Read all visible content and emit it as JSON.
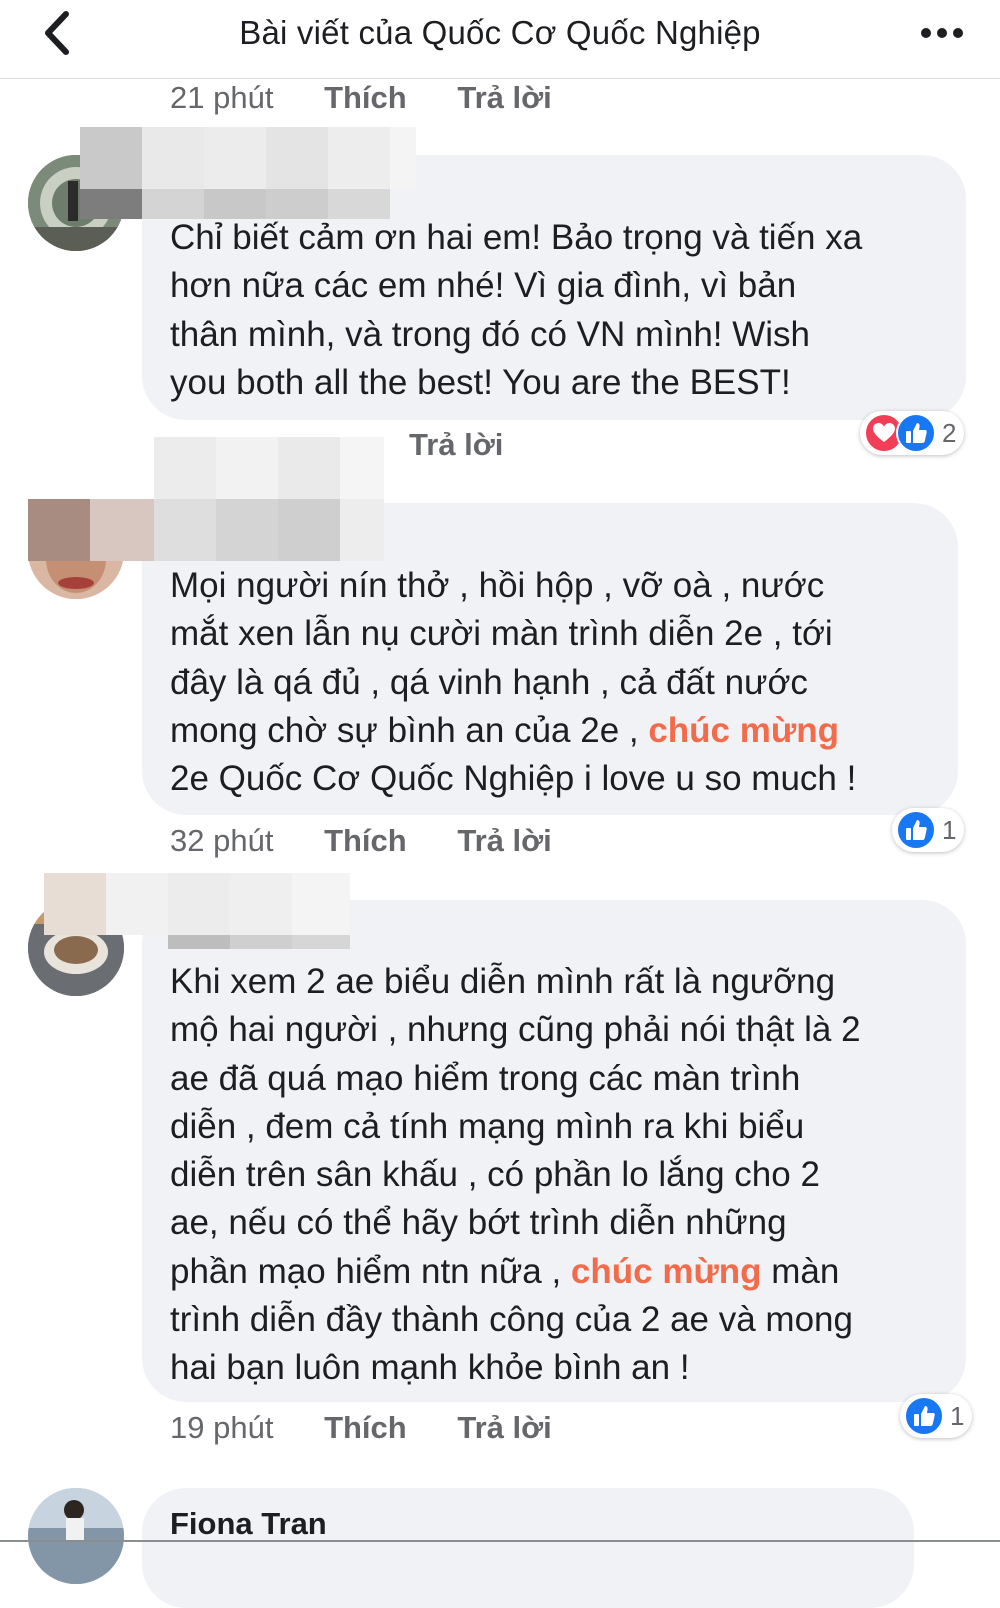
{
  "header": {
    "title": "Bài viết của Quốc Cơ Quốc Nghiệp",
    "back_icon": "chevron-left-icon",
    "more_icon": "more-horizontal-icon"
  },
  "comments": [
    {
      "time": "21 phút",
      "like_label": "Thích",
      "reply_label": "Trả lời"
    },
    {
      "lines": [
        "Chỉ biết cảm ơn hai em! Bảo trọng và tiến xa",
        "hơn nữa các em nhé! Vì gia đình, vì bản",
        "thân mình, và trong đó có VN mình! Wish",
        "you both all the best! You are the BEST!"
      ],
      "reaction_count": "2",
      "reaction_icons": [
        "love-icon",
        "like-icon"
      ],
      "reply_label": "Trả lời"
    },
    {
      "lines": [
        "Mọi người nín thở , hồi hộp , vỡ oà , nước",
        "mắt xen lẫn nụ cười màn trình diễn 2e , tới",
        "đây là qá đủ , qá vinh hạnh , cả đất nước"
      ],
      "line4_before": "mong chờ sự bình an của 2e , ",
      "highlight": "chúc mừng",
      "line5": "2e Quốc Cơ Quốc Nghiệp i love u so much !",
      "reaction_count": "1",
      "time": "32 phút",
      "like_label": "Thích",
      "reply_label": "Trả lời"
    },
    {
      "lines": [
        "Khi xem 2 ae biểu diễn mình rất là ngưỡng",
        "mộ hai người , nhưng cũng phải nói thật là 2",
        "ae đã quá mạo hiểm trong các màn trình",
        "diễn , đem cả tính mạng mình ra khi biểu",
        "diễn trên sân khấu , có phần lo lắng cho 2",
        "ae, nếu có thể hãy bớt trình diễn những"
      ],
      "line7_before": "phần mạo hiểm ntn nữa , ",
      "highlight": "chúc mừng",
      "line7_after": " màn",
      "lines_end": [
        "trình diễn đầy thành công của 2 ae và mong",
        "hai bạn luôn mạnh khỏe bình an !"
      ],
      "reaction_count": "1",
      "time": "19 phút",
      "like_label": "Thích",
      "reply_label": "Trả lời"
    },
    {
      "name": "Fiona Tran"
    }
  ],
  "colors": {
    "bubble": "#f0f2f5",
    "highlight": "#f26b4a",
    "meta": "#65676b",
    "like": "#1877f2",
    "love": "#f33e58"
  }
}
